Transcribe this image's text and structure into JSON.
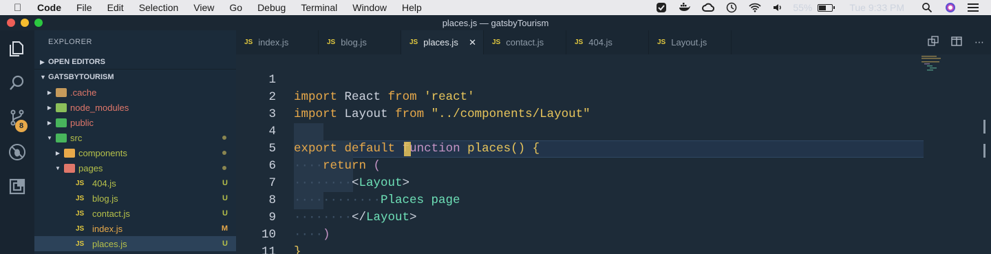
{
  "menubar": {
    "app_name": "Code",
    "menus": [
      "File",
      "Edit",
      "Selection",
      "View",
      "Go",
      "Debug",
      "Terminal",
      "Window",
      "Help"
    ],
    "battery_text": "55%",
    "battery_level": 0.55,
    "clock": "Tue 9:33 PM"
  },
  "window": {
    "title": "places.js — gatsbyTourism"
  },
  "activity": {
    "scm_badge": "8"
  },
  "sidebar": {
    "title": "EXPLORER",
    "open_editors": "OPEN EDITORS",
    "project": "GATSBYTOURISM",
    "tree": [
      {
        "label": ".cache",
        "kind": "folder",
        "color": "#e0776a"
      },
      {
        "label": "node_modules",
        "kind": "folder",
        "color": "#e0776a"
      },
      {
        "label": "public",
        "kind": "folder",
        "color": "#e0776a"
      },
      {
        "label": "src",
        "kind": "folder",
        "color": "#b6c04a"
      },
      {
        "label": "components",
        "kind": "folder",
        "color": "#b6c04a"
      },
      {
        "label": "pages",
        "kind": "folder",
        "color": "#b6c04a"
      },
      {
        "label": "404.js",
        "kind": "file",
        "status": "U",
        "color": "#b6c04a"
      },
      {
        "label": "blog.js",
        "kind": "file",
        "status": "U",
        "color": "#b6c04a"
      },
      {
        "label": "contact.js",
        "kind": "file",
        "status": "U",
        "color": "#b6c04a"
      },
      {
        "label": "index.js",
        "kind": "file",
        "status": "M",
        "color": "#e8a94a"
      },
      {
        "label": "places.js",
        "kind": "file",
        "status": "U",
        "color": "#b6c04a"
      }
    ]
  },
  "tabs": [
    {
      "label": "index.js"
    },
    {
      "label": "blog.js"
    },
    {
      "label": "places.js",
      "active": true
    },
    {
      "label": "contact.js"
    },
    {
      "label": "404.js"
    },
    {
      "label": "Layout.js"
    }
  ],
  "tab_icon_text": "JS",
  "editor": {
    "line_numbers": [
      "1",
      "2",
      "3",
      "4",
      "5",
      "6",
      "7",
      "8",
      "9",
      "10",
      "11"
    ],
    "l1": {
      "kw1": "import",
      "name": "React",
      "kw2": "from",
      "str": "'react'"
    },
    "l2": {
      "kw1": "import",
      "name": "Layout",
      "kw2": "from",
      "str": "\"../components/Layout\""
    },
    "l4": {
      "kw1": "export",
      "kw2": "default",
      "kw3": "function",
      "fn": "places",
      "rest": "() {"
    },
    "l5": {
      "kw": "return",
      "rest": "("
    },
    "l6": {
      "open": "<",
      "tag": "Layout",
      "close": ">"
    },
    "l7": {
      "text": "Places page"
    },
    "l8": {
      "open": "</",
      "tag": "Layout",
      "close": ">"
    },
    "l9": {
      "text": ")"
    },
    "l10": {
      "text": "}"
    }
  }
}
